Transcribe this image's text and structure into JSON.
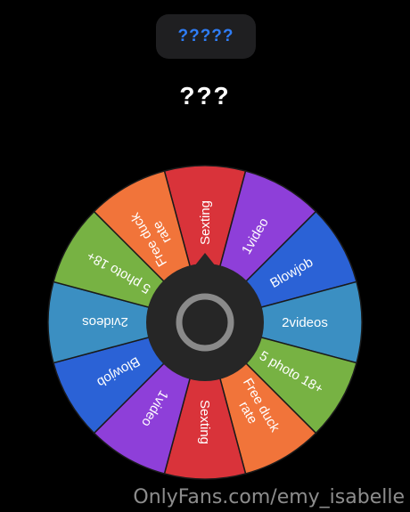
{
  "header": {
    "spin_label": "?????"
  },
  "result": {
    "text": "???"
  },
  "wheel": {
    "segments": [
      {
        "label": "Sexting",
        "color": "#d9333a"
      },
      {
        "label": "1video",
        "color": "#8e3fd9"
      },
      {
        "label": "Blowjob",
        "color": "#2b62d6"
      },
      {
        "label": "2videos",
        "color": "#3b8fc2"
      },
      {
        "label": "5 photo 18+",
        "color": "#77b243"
      },
      {
        "label": "Free duck\nrate",
        "color": "#f1743a"
      },
      {
        "label": "Sexting",
        "color": "#d9333a"
      },
      {
        "label": "1video",
        "color": "#8e3fd9"
      },
      {
        "label": "Blowjob",
        "color": "#2b62d6"
      },
      {
        "label": "2videos",
        "color": "#3b8fc2"
      },
      {
        "label": "5 photo 18+",
        "color": "#77b243"
      },
      {
        "label": "Free duck\nrate",
        "color": "#f1743a"
      }
    ],
    "hub_color": "#262626",
    "hub_ring_color": "#8a8a8a"
  },
  "watermark": {
    "text": "OnlyFans.com/emy_isabelle"
  }
}
